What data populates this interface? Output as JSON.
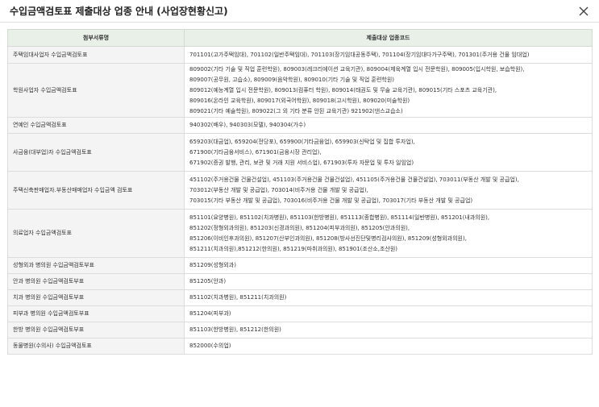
{
  "modal": {
    "title": "수입금액검토표 제출대상 업종 안내 (사업장현황신고)",
    "close_label": "✕"
  },
  "table": {
    "headers": [
      "첨부서류명",
      "제출대상 업종코드"
    ],
    "rows": [
      {
        "type": "주택임대사업자 수입금액검토표",
        "codes": [
          "701101(고가주택임대), 701102(일반주택임대), 701103(장기임대공동주택), 701104(장기임대다가구주택), 701301(주거용 건물 임대업)"
        ]
      },
      {
        "type": "학원사업자 수입금액검토표",
        "codes": [
          "809002(기타 기술 및 직업 훈련학원), 809003(레크리에이션 교육기관), 809004(제육계열 입시 전문학원), 809005(입시학원, 보습학원),",
          "809007(공무원, 고습소), 809009(음악학원), 809010(기타 기술 및 직업 훈련학원)",
          "809012(예능계열 입시 전문학원), 809013(컴퓨터 학원), 809014(태권도 및 무술 교육기관), 809015(기타 스포츠 교육기관),",
          "809016(온라인 교육학원), 809017(외국어학원), 809018(고시학원), 809020(미술학원)",
          "809021(기타 예술학원), 809022(그 외 기타 분류 안된 교육기관) 921902(댄스교습소)"
        ]
      },
      {
        "type": "연예인 수입금액검토표",
        "codes": [
          "940302(배우), 940303(모델), 940304(가수)"
        ]
      },
      {
        "type": "사금융(대부업)자 수입금액검토표",
        "codes": [
          "659203(대금업), 659204(전당포), 659900(기타금융업), 659903(신탁업 및 집합 투자업),",
          "671900(기타금융서비스), 671901(금융시장 관리업),",
          "671902(증권 발행, 관리, 보관 및 거래 지원 서비스업), 671903(투자 자문업 및 투자 일임업)"
        ]
      },
      {
        "type": "주택신축판매업자.부동산매매업자 수입금액 검토표",
        "codes": [
          "451102(주거용건물 건물건설업), 451103(주거용건물 건물건설업), 451105(주거용건물 건물건설업), 703011(부동산 개발 및 공급업),",
          "703012(부동산 개발 및 공급업), 703014(비주거용 건물 개발 및 공급업),",
          "703015(기타 부동산 개발 및 공급업), 703016(비주거용 건물 개발 및 공급업), 703017(기타 부동산 개발 및 공급업)"
        ]
      },
      {
        "type": "의료업자 수입금액검토표",
        "codes": [
          "851101(요양병원), 851102(치과병원), 851103(한방병원), 851113(종합병원), 851114(일반병원), 851201(내과의원),",
          "851202(정형외과의원), 851203(신경과의원), 851204(피부과의원), 851205(안과의원),",
          "851206(이비인후과의원), 851207(산부인과의원), 851208(방사선진단및병리검사의원), 851209(성형외과의원),",
          "851211(치과의원),851212(한의원), 851219(마취과의원), 851901(조산소,조산원)"
        ]
      },
      {
        "type": "성형외과 병의원 수입금액검토부표",
        "codes": [
          "851209(성형외과)"
        ]
      },
      {
        "type": "안과 병의원 수입금액검토부표",
        "codes": [
          "851205(안과)"
        ]
      },
      {
        "type": "치과 병의원 수입금액검토부표",
        "codes": [
          "851102(치과병원), 851211(치과의원)"
        ]
      },
      {
        "type": "피부과 병의원 수입금액검토부표",
        "codes": [
          "851204(피부과)"
        ]
      },
      {
        "type": "한방 병의원 수입금액검토부표",
        "codes": [
          "851103(한방병원), 851212(한의원)"
        ]
      },
      {
        "type": "동물병원(수의사) 수입금액검토표",
        "codes": [
          "852000(수의업)"
        ]
      }
    ]
  }
}
